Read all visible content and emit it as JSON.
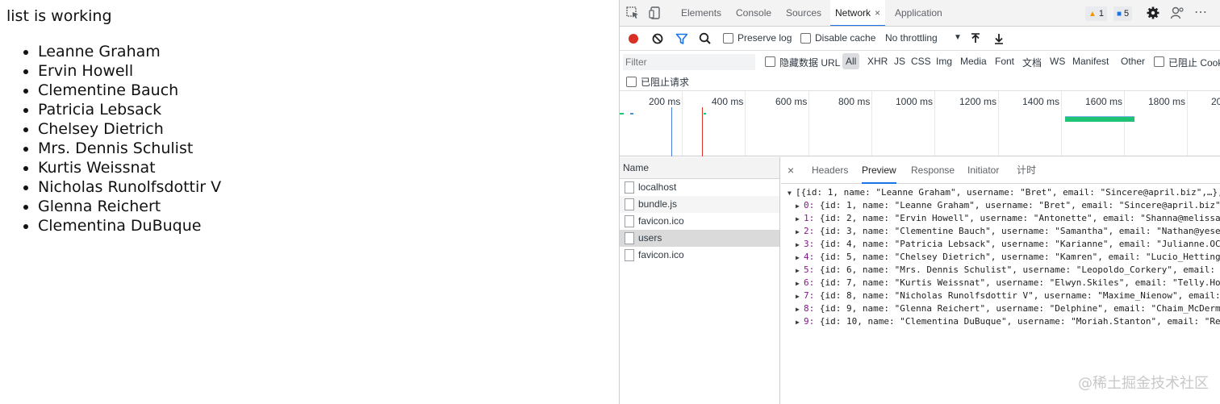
{
  "page": {
    "heading": "list is working",
    "users": [
      "Leanne Graham",
      "Ervin Howell",
      "Clementine Bauch",
      "Patricia Lebsack",
      "Chelsey Dietrich",
      "Mrs. Dennis Schulist",
      "Kurtis Weissnat",
      "Nicholas Runolfsdottir V",
      "Glenna Reichert",
      "Clementina DuBuque"
    ]
  },
  "devtools": {
    "tabs": [
      "Elements",
      "Console",
      "Sources",
      "Network",
      "Application"
    ],
    "active_tab": "Network",
    "tab_close": "×",
    "warnings_count": "1",
    "messages_count": "5",
    "toolbar": {
      "preserve_log": "Preserve log",
      "disable_cache": "Disable cache",
      "throttling": "No throttling"
    },
    "filter": {
      "placeholder": "Filter",
      "hide_data_urls": "隐藏数据 URL",
      "types": [
        "All",
        "XHR",
        "JS",
        "CSS",
        "Img",
        "Media",
        "Font",
        "文档",
        "WS",
        "Manifest",
        "Other"
      ],
      "blocked_cookies": "已阻止 Cookie",
      "blocked_requests": "已阻止请求"
    },
    "timeline": {
      "labels": [
        "200 ms",
        "400 ms",
        "600 ms",
        "800 ms",
        "1000 ms",
        "1200 ms",
        "1400 ms",
        "1600 ms",
        "1800 ms",
        "20"
      ]
    },
    "requests": {
      "header": "Name",
      "items": [
        "localhost",
        "bundle.js",
        "favicon.ico",
        "users",
        "favicon.ico"
      ],
      "selected": "users"
    },
    "detail": {
      "close": "×",
      "tabs": [
        "Headers",
        "Preview",
        "Response",
        "Initiator",
        "计时"
      ],
      "active_tab": "Preview",
      "preview_root": "[{id: 1, name: \"Leanne Graham\", username: \"Bret\", email: \"Sincere@april.biz\",…},",
      "preview_rows": [
        {
          "index": "0:",
          "text": " {id: 1, name: \"Leanne Graham\", username: \"Bret\", email: \"Sincere@april.biz\""
        },
        {
          "index": "1:",
          "text": " {id: 2, name: \"Ervin Howell\", username: \"Antonette\", email: \"Shanna@melissa"
        },
        {
          "index": "2:",
          "text": " {id: 3, name: \"Clementine Bauch\", username: \"Samantha\", email: \"Nathan@yese"
        },
        {
          "index": "3:",
          "text": " {id: 4, name: \"Patricia Lebsack\", username: \"Karianne\", email: \"Julianne.OC"
        },
        {
          "index": "4:",
          "text": " {id: 5, name: \"Chelsey Dietrich\", username: \"Kamren\", email: \"Lucio_Hetting"
        },
        {
          "index": "5:",
          "text": " {id: 6, name: \"Mrs. Dennis Schulist\", username: \"Leopoldo_Corkery\", email: "
        },
        {
          "index": "6:",
          "text": " {id: 7, name: \"Kurtis Weissnat\", username: \"Elwyn.Skiles\", email: \"Telly.Ho"
        },
        {
          "index": "7:",
          "text": " {id: 8, name: \"Nicholas Runolfsdottir V\", username: \"Maxime_Nienow\", email:"
        },
        {
          "index": "8:",
          "text": " {id: 9, name: \"Glenna Reichert\", username: \"Delphine\", email: \"Chaim_McDerm"
        },
        {
          "index": "9:",
          "text": " {id: 10, name: \"Clementina DuBuque\", username: \"Moriah.Stanton\", email: \"Re"
        }
      ]
    }
  },
  "watermark": "@稀土掘金技术社区",
  "colors": {
    "accent": "#1a73e8",
    "record": "#d93025",
    "filter_active": "#1a73e8",
    "bar": "#1ec375"
  }
}
